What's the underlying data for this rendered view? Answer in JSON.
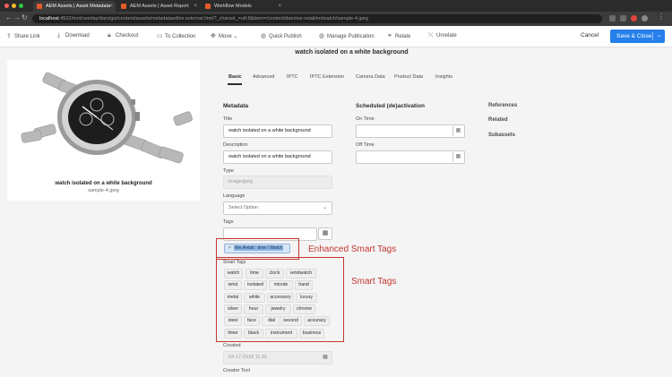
{
  "browser": {
    "tabs": [
      {
        "label": "AEM Assets | Asset Metadata",
        "active": true
      },
      {
        "label": "AEM Assets | Asset Report",
        "active": false
      },
      {
        "label": "Workflow Models",
        "active": false
      }
    ],
    "url_host": "localhost",
    "url_path": ":4502/mnt/overlay/dam/gui/content/assets/metadataeditor.external.html?_charset_=utf-8&item=/content/dam/we-retail/en/watch/sample-4.jpeg"
  },
  "toolbar": {
    "items": [
      {
        "label": "Share Link",
        "icon": "share-icon"
      },
      {
        "label": "Download",
        "icon": "download-icon"
      },
      {
        "label": "Checkout",
        "icon": "lock-icon"
      },
      {
        "label": "To Collection",
        "icon": "collection-icon"
      },
      {
        "label": "Move",
        "icon": "move-icon"
      },
      {
        "label": "Quick Publish",
        "icon": "globe-icon"
      },
      {
        "label": "Manage Publication",
        "icon": "globe-icon"
      },
      {
        "label": "Relate",
        "icon": "relate-icon"
      },
      {
        "label": "Unrelate",
        "icon": "unrelate-icon"
      }
    ],
    "cancel_label": "Cancel",
    "save_label": "Save & Close"
  },
  "preview": {
    "title": "watch isolated on a white background",
    "filename": "sample-4.jpeg"
  },
  "page_title": "watch isolated on a white background",
  "tabs": [
    "Basic",
    "Advanced",
    "IPTC",
    "IPTC Extension",
    "Camera Data",
    "Product Data",
    "Insights"
  ],
  "metadata": {
    "heading": "Metadata",
    "title_label": "Title",
    "title_value": "watch isolated on a white background",
    "description_label": "Description",
    "description_value": "watch isolated on a white background",
    "type_label": "Type",
    "type_value": "image/jpeg",
    "language_label": "Language",
    "language_value": "Select Option",
    "tags_label": "Tags",
    "enhanced_tag": "We.Retail : time / Watch",
    "smart_tags_label": "Smart Tags",
    "smart_tags": [
      "watch",
      "time",
      "clock",
      "wristwatch",
      "wrist",
      "isolated",
      "minute",
      "hand",
      "metal",
      "white",
      "accessory",
      "luxury",
      "silver",
      "hour",
      "jewelry",
      "chrome",
      "steel",
      "face",
      "dial",
      "second",
      "accuracy",
      "timer",
      "black",
      "instrument",
      "business"
    ],
    "created_label": "Created",
    "created_value": "04-17-2018 11:32",
    "creator_tool_label": "Creator Tool"
  },
  "schedule": {
    "heading": "Scheduled (de)activation",
    "on_time_label": "On Time",
    "off_time_label": "Off Time"
  },
  "right_links": [
    "References",
    "Related",
    "Subassets"
  ],
  "annotations": {
    "enhanced": "Enhanced Smart Tags",
    "smart": "Smart Tags"
  },
  "colors": {
    "accent": "#2680eb",
    "annotation": "#c5362e"
  }
}
